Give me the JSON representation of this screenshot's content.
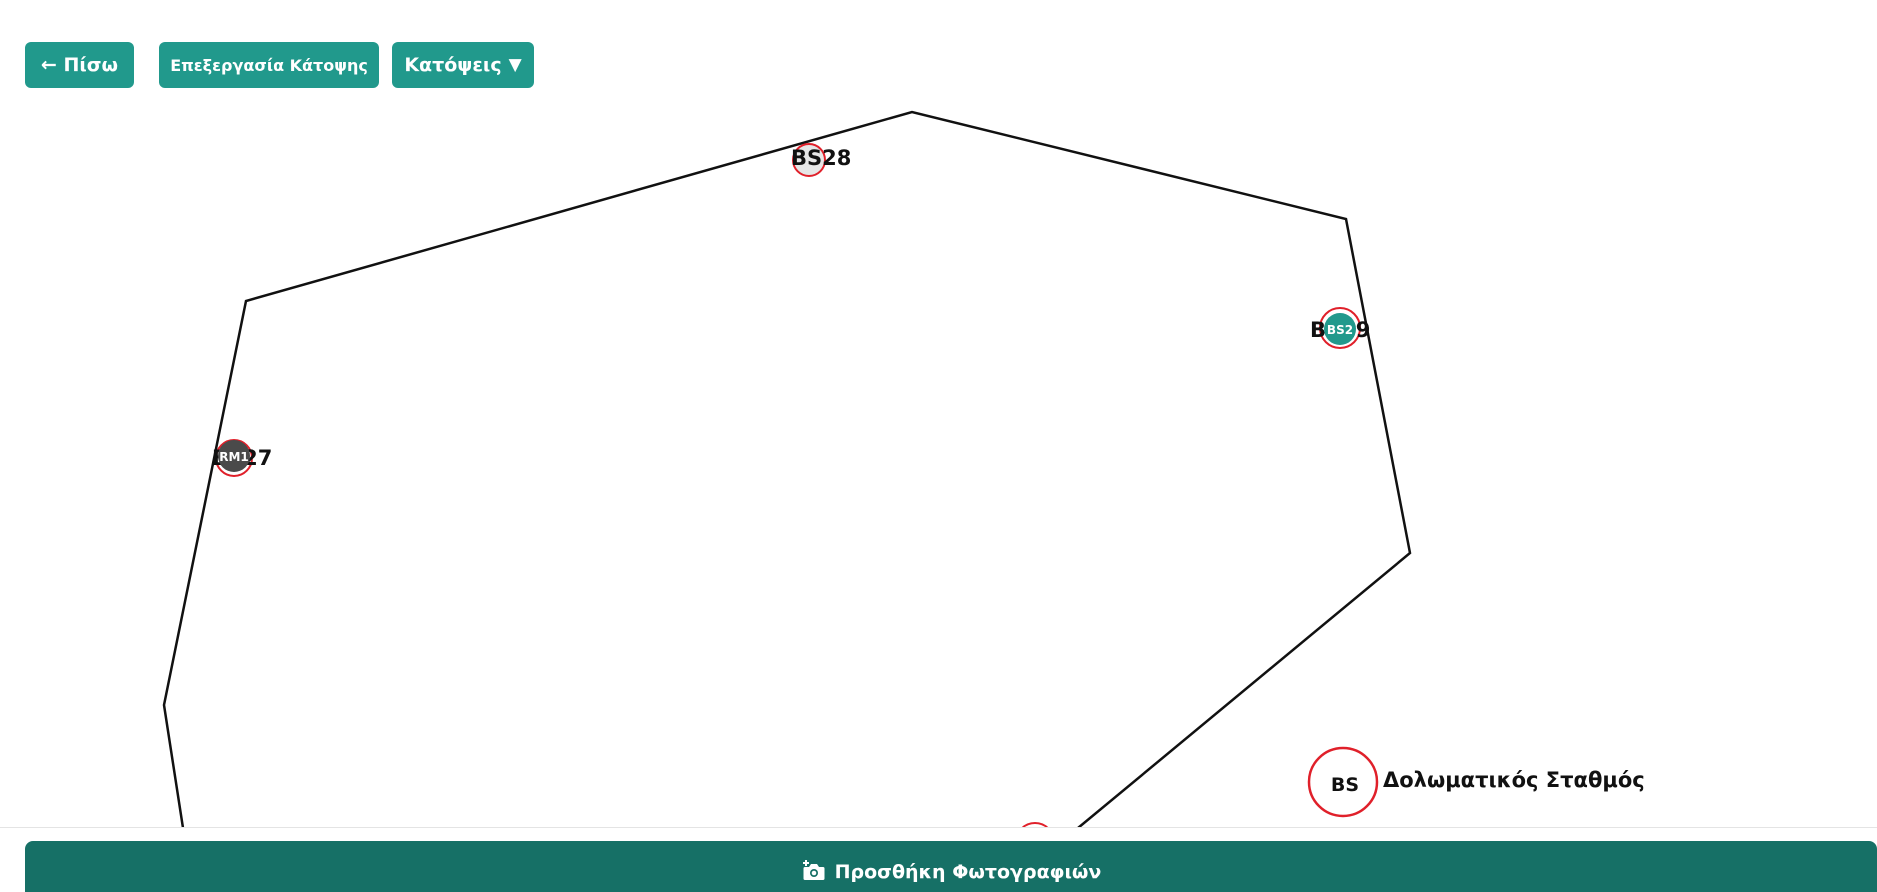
{
  "toolbar": {
    "back_label": "← Πίσω",
    "edit_plan_label": "Επεξεργασία Κάτοψης",
    "plans_label": "Κατόψεις",
    "plans_caret": "▼"
  },
  "markers": {
    "bs28": {
      "label": "BS28",
      "bubble_text": ""
    },
    "bs29": {
      "label": "BS29",
      "bubble_text": "BS2"
    },
    "bs27": {
      "label": "BS27",
      "bubble_text": "RM1"
    }
  },
  "legend": {
    "symbol": "BS",
    "text": "Δολωματικός Σταθμός"
  },
  "bottom": {
    "add_photos_label": "Προσθήκη Φωτογραφιών"
  },
  "colors": {
    "primary": "#21998c",
    "bottom_bar": "#167066",
    "marker_ring": "#e0202a",
    "marker_active": "#21998c",
    "marker_dark": "#4a4a4a"
  }
}
